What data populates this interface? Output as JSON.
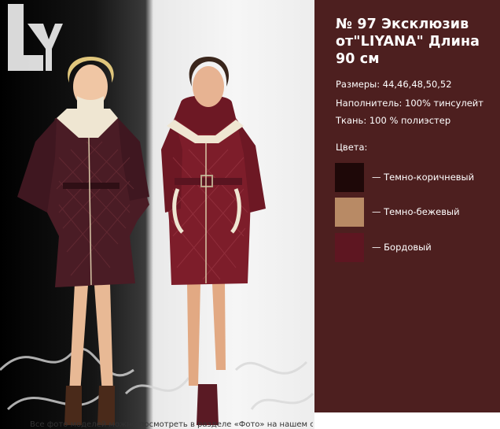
{
  "product": {
    "title_line1": "№ 97 Эксклюзив",
    "title_line2": "от\"LIYANA\" Длина",
    "title_line3": "90 см",
    "sizes": "Размеры: 44,46,48,50,52",
    "filler": "Наполнитель: 100% тинсулейт",
    "fabric": "Ткань: 100 % полиэстер"
  },
  "colors": {
    "heading": "Цвета:",
    "items": [
      {
        "label": "— Темно-коричневый",
        "color": "#1e0808"
      },
      {
        "label": "— Темно-бежевый",
        "color": "#b88a65"
      },
      {
        "label": "— Бордовый",
        "color": "#5e1621"
      }
    ]
  },
  "photo": {
    "watermark_text": "LY",
    "caption": "Все фото моделей можно посмотреть в разделе «Фото» на нашем сайте"
  },
  "theme": {
    "panel_bg": "#4d1f1f",
    "coat_brown": "#4a1c25",
    "coat_red": "#7d1d2a"
  }
}
